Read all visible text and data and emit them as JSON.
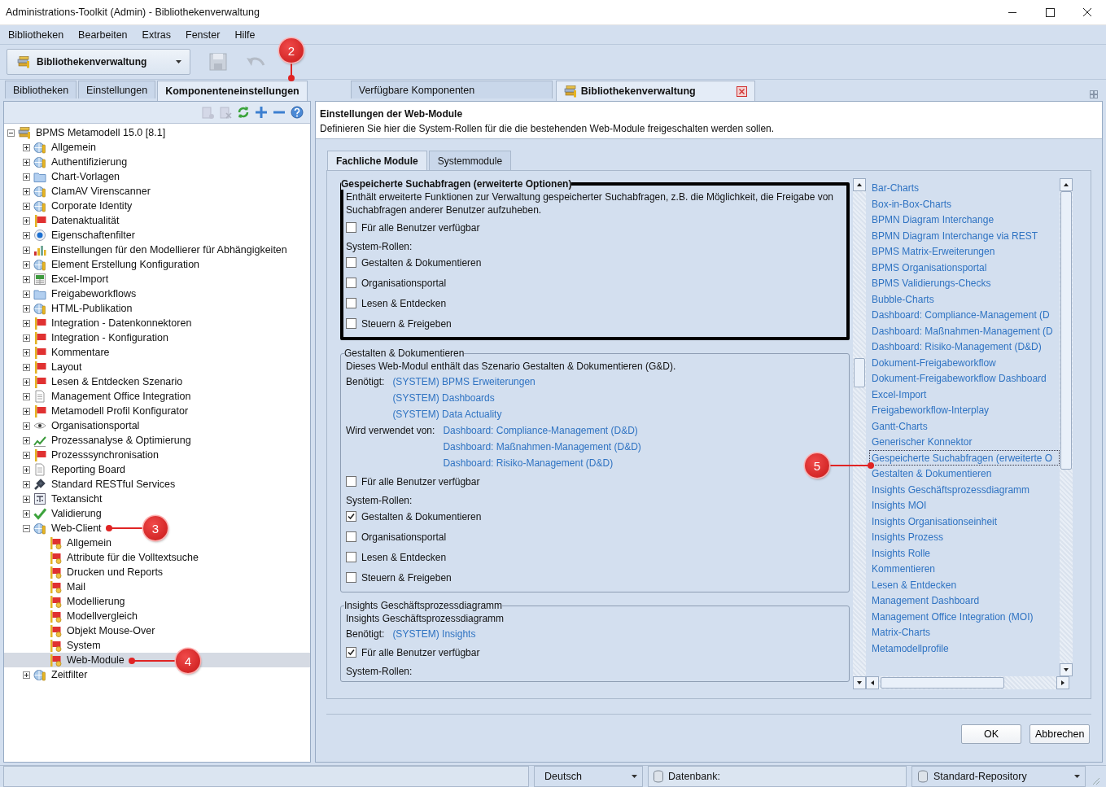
{
  "window": {
    "title": "Administrations-Toolkit (Admin) - Bibliothekenverwaltung"
  },
  "menu": [
    "Bibliotheken",
    "Bearbeiten",
    "Extras",
    "Fenster",
    "Hilfe"
  ],
  "toolbar": {
    "library_selector": "Bibliothekenverwaltung",
    "buttons": [
      {
        "kind": "save",
        "disabled": true
      },
      {
        "kind": "undo",
        "disabled": true
      }
    ]
  },
  "left_tabs": [
    {
      "label": "Bibliotheken",
      "selected": false
    },
    {
      "label": "Einstellungen",
      "selected": false
    },
    {
      "label": "Komponenteneinstellungen",
      "selected": true
    }
  ],
  "right_tabs": [
    {
      "label": "Verfügbare Komponenten",
      "selected": false,
      "closable": false
    },
    {
      "label": "Bibliothekenverwaltung",
      "selected": true,
      "closable": true
    }
  ],
  "tree_toolbar": [
    {
      "kind": "new",
      "disabled": true
    },
    {
      "kind": "delete",
      "disabled": true
    },
    {
      "kind": "refresh",
      "disabled": false
    },
    {
      "kind": "add",
      "disabled": false
    },
    {
      "kind": "remove",
      "disabled": false
    },
    {
      "kind": "help",
      "disabled": false
    }
  ],
  "tree": {
    "label": "BPMS Metamodell 15.0 [8.1]",
    "kind": "library",
    "expanded": true,
    "selected": false,
    "children": [
      {
        "label": "Allgemein",
        "kind": "globe",
        "expanded": false,
        "selected": false
      },
      {
        "label": "Authentifizierung",
        "kind": "globe",
        "expanded": false,
        "selected": false
      },
      {
        "label": "Chart-Vorlagen",
        "kind": "folder",
        "expanded": false,
        "selected": false
      },
      {
        "label": "ClamAV Virenscanner",
        "kind": "globe",
        "expanded": false,
        "selected": false
      },
      {
        "label": "Corporate Identity",
        "kind": "globe",
        "expanded": false,
        "selected": false
      },
      {
        "label": "Datenaktualität",
        "kind": "flag",
        "expanded": false,
        "selected": false
      },
      {
        "label": "Eigenschaftenfilter",
        "kind": "target",
        "expanded": false,
        "selected": false
      },
      {
        "label": "Einstellungen für den Modellierer für Abhängigkeiten",
        "kind": "chart",
        "expanded": false,
        "selected": false
      },
      {
        "label": "Element Erstellung Konfiguration",
        "kind": "globe",
        "expanded": false,
        "selected": false
      },
      {
        "label": "Excel-Import",
        "kind": "sheet",
        "expanded": false,
        "selected": false
      },
      {
        "label": "Freigabeworkflows",
        "kind": "folder",
        "expanded": false,
        "selected": false
      },
      {
        "label": "HTML-Publikation",
        "kind": "globe",
        "expanded": false,
        "selected": false
      },
      {
        "label": "Integration - Datenkonnektoren",
        "kind": "flag",
        "expanded": false,
        "selected": false
      },
      {
        "label": "Integration - Konfiguration",
        "kind": "flag",
        "expanded": false,
        "selected": false
      },
      {
        "label": "Kommentare",
        "kind": "flag",
        "expanded": false,
        "selected": false
      },
      {
        "label": "Layout",
        "kind": "flag",
        "expanded": false,
        "selected": false
      },
      {
        "label": "Lesen & Entdecken Szenario",
        "kind": "flag",
        "expanded": false,
        "selected": false
      },
      {
        "label": "Management Office Integration",
        "kind": "document",
        "expanded": false,
        "selected": false
      },
      {
        "label": "Metamodell Profil Konfigurator",
        "kind": "flag",
        "expanded": false,
        "selected": false
      },
      {
        "label": "Organisationsportal",
        "kind": "eye",
        "expanded": false,
        "selected": false
      },
      {
        "label": "Prozessanalyse & Optimierung",
        "kind": "trend",
        "expanded": false,
        "selected": false
      },
      {
        "label": "Prozesssynchronisation",
        "kind": "flag",
        "expanded": false,
        "selected": false
      },
      {
        "label": "Reporting Board",
        "kind": "document",
        "expanded": false,
        "selected": false
      },
      {
        "label": "Standard RESTful Services",
        "kind": "plug",
        "expanded": false,
        "selected": false
      },
      {
        "label": "Textansicht",
        "kind": "text",
        "expanded": false,
        "selected": false
      },
      {
        "label": "Validierung",
        "kind": "check",
        "expanded": false,
        "selected": false
      },
      {
        "label": "Web-Client",
        "kind": "globe",
        "expanded": true,
        "selected": false,
        "children": [
          {
            "label": "Allgemein",
            "kind": "flag-gear",
            "selected": false
          },
          {
            "label": "Attribute für die Volltextsuche",
            "kind": "flag-gear",
            "selected": false
          },
          {
            "label": "Drucken und Reports",
            "kind": "flag-gear",
            "selected": false
          },
          {
            "label": "Mail",
            "kind": "flag-gear",
            "selected": false
          },
          {
            "label": "Modellierung",
            "kind": "flag-gear",
            "selected": false
          },
          {
            "label": "Modellvergleich",
            "kind": "flag-gear",
            "selected": false
          },
          {
            "label": "Objekt Mouse-Over",
            "kind": "flag-gear",
            "selected": false
          },
          {
            "label": "System",
            "kind": "flag-gear",
            "selected": false
          },
          {
            "label": "Web-Module",
            "kind": "flag-gear",
            "selected": true
          }
        ]
      },
      {
        "label": "Zeitfilter",
        "kind": "globe",
        "expanded": false,
        "selected": false
      }
    ]
  },
  "settings": {
    "title": "Einstellungen der Web-Module",
    "description": "Definieren Sie hier die System-Rollen für die die bestehenden Web-Module freigeschalten werden sollen.",
    "tabs": [
      {
        "label": "Fachliche Module",
        "selected": true
      },
      {
        "label": "Systemmodule",
        "selected": false
      }
    ],
    "sections": [
      {
        "title": "Gespeicherte Suchabfragen (erweiterte Optionen)",
        "highlighted": true,
        "description": "Enthält erweiterte Funktionen zur Verwaltung gespeicherter Suchabfragen, z.B. die Möglichkeit, die Freigabe von Suchabfragen anderer Benutzer aufzuheben.",
        "all_users": {
          "label": "Für alle Benutzer verfügbar",
          "checked": false
        },
        "roles_label": "System-Rollen:",
        "roles": [
          {
            "label": "Gestalten & Dokumentieren",
            "checked": false
          },
          {
            "label": "Organisationsportal",
            "checked": false
          },
          {
            "label": "Lesen & Entdecken",
            "checked": false
          },
          {
            "label": "Steuern & Freigeben",
            "checked": false
          }
        ]
      },
      {
        "title": "Gestalten & Dokumentieren",
        "highlighted": false,
        "description": "Dieses Web-Modul enthält das Szenario Gestalten & Dokumentieren (G&D).",
        "requires_label": "Benötigt:",
        "requires": [
          "(SYSTEM) BPMS Erweiterungen",
          "(SYSTEM) Dashboards",
          "(SYSTEM) Data Actuality"
        ],
        "used_by_label": "Wird verwendet von:",
        "used_by": [
          "Dashboard: Compliance-Management (D&D)",
          "Dashboard: Maßnahmen-Management (D&D)",
          "Dashboard: Risiko-Management (D&D)"
        ],
        "all_users": {
          "label": "Für alle Benutzer verfügbar",
          "checked": false
        },
        "roles_label": "System-Rollen:",
        "roles": [
          {
            "label": "Gestalten & Dokumentieren",
            "checked": true
          },
          {
            "label": "Organisationsportal",
            "checked": false
          },
          {
            "label": "Lesen & Entdecken",
            "checked": false
          },
          {
            "label": "Steuern & Freigeben",
            "checked": false
          }
        ]
      },
      {
        "title": "Insights Geschäftsprozessdiagramm",
        "highlighted": false,
        "description": "Insights Geschäftsprozessdiagramm",
        "requires_label": "Benötigt:",
        "requires": [
          "(SYSTEM) Insights"
        ],
        "all_users": {
          "label": "Für alle Benutzer verfügbar",
          "checked": true
        },
        "roles_label": "System-Rollen:"
      }
    ],
    "modules": [
      {
        "label": "Bar-Charts",
        "selected": false
      },
      {
        "label": "Box-in-Box-Charts",
        "selected": false
      },
      {
        "label": "BPMN Diagram Interchange",
        "selected": false
      },
      {
        "label": "BPMN Diagram Interchange via REST",
        "selected": false
      },
      {
        "label": "BPMS Matrix-Erweiterungen",
        "selected": false
      },
      {
        "label": "BPMS Organisationsportal",
        "selected": false
      },
      {
        "label": "BPMS Validierungs-Checks",
        "selected": false
      },
      {
        "label": "Bubble-Charts",
        "selected": false
      },
      {
        "label": "Dashboard: Compliance-Management (D",
        "selected": false
      },
      {
        "label": "Dashboard: Maßnahmen-Management (D",
        "selected": false
      },
      {
        "label": "Dashboard: Risiko-Management (D&D)",
        "selected": false
      },
      {
        "label": "Dokument-Freigabeworkflow",
        "selected": false
      },
      {
        "label": "Dokument-Freigabeworkflow Dashboard",
        "selected": false
      },
      {
        "label": "Excel-Import",
        "selected": false
      },
      {
        "label": "Freigabeworkflow-Interplay",
        "selected": false
      },
      {
        "label": "Gantt-Charts",
        "selected": false
      },
      {
        "label": "Generischer Konnektor",
        "selected": false
      },
      {
        "label": "Gespeicherte Suchabfragen (erweiterte O",
        "selected": true
      },
      {
        "label": "Gestalten & Dokumentieren",
        "selected": false
      },
      {
        "label": "Insights Geschäftsprozessdiagramm",
        "selected": false
      },
      {
        "label": "Insights MOI",
        "selected": false
      },
      {
        "label": "Insights Organisationseinheit",
        "selected": false
      },
      {
        "label": "Insights Prozess",
        "selected": false
      },
      {
        "label": "Insights Rolle",
        "selected": false
      },
      {
        "label": "Kommentieren",
        "selected": false
      },
      {
        "label": "Lesen & Entdecken",
        "selected": false
      },
      {
        "label": "Management Dashboard",
        "selected": false
      },
      {
        "label": "Management Office Integration (MOI)",
        "selected": false
      },
      {
        "label": "Matrix-Charts",
        "selected": false
      },
      {
        "label": "Metamodellprofile",
        "selected": false
      }
    ],
    "buttons": [
      "OK",
      "Abbrechen"
    ]
  },
  "status_bar": {
    "language": "Deutsch",
    "database_label": "Datenbank:",
    "repository": "Standard-Repository"
  },
  "callouts": [
    {
      "label": "2"
    },
    {
      "label": "3"
    },
    {
      "label": "4"
    },
    {
      "label": "5"
    }
  ]
}
